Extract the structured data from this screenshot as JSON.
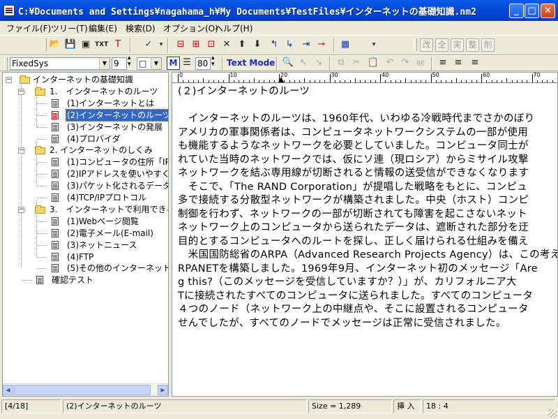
{
  "window": {
    "title": "C:¥Documents and Settings¥nagahama_h¥My Documents¥TestFiles¥インターネットの基礎知識.nm2",
    "minimize": "_",
    "maximize": "□",
    "close": "✕"
  },
  "menu": [
    "ファイル(F)",
    "ツリー(T)",
    "編集(E)",
    "検索(D)",
    "オプション(O)",
    "ヘルプ(H)"
  ],
  "toolbar1": {
    "kanji_buttons": [
      "改",
      "全",
      "実",
      "整",
      "削"
    ]
  },
  "toolbar2": {
    "font": "FixedSys",
    "font_size": "9",
    "box_option": "□",
    "m_label": "M",
    "indent": "80",
    "text_mode": "Text Mode"
  },
  "tree": {
    "root": "インターネットの基礎知識",
    "nodes": [
      {
        "label": "1.　インターネットのルーツ",
        "level": 1,
        "type": "folder"
      },
      {
        "label": "(1)インターネットとは",
        "level": 2,
        "type": "page"
      },
      {
        "label": "(2)インターネットのルーツ",
        "level": 2,
        "type": "page",
        "selected": true
      },
      {
        "label": "(3)インターネットの発展",
        "level": 2,
        "type": "page"
      },
      {
        "label": "(4)プロバイダ",
        "level": 2,
        "type": "page"
      },
      {
        "label": "2. インターネットのしくみ",
        "level": 1,
        "type": "folder"
      },
      {
        "label": "(1)コンピュータの住所「IP7",
        "level": 2,
        "type": "page"
      },
      {
        "label": "(2)IPアドレスを使いやすく",
        "level": 2,
        "type": "page"
      },
      {
        "label": "(3)パケット化されるデータ",
        "level": 2,
        "type": "page"
      },
      {
        "label": "(4)TCP/IPプロトコル",
        "level": 2,
        "type": "page"
      },
      {
        "label": "3.　インターネットで利用できる",
        "level": 1,
        "type": "folder"
      },
      {
        "label": "(1)Webページ閲覧",
        "level": 2,
        "type": "page"
      },
      {
        "label": "(2)電子メール(E-mail)",
        "level": 2,
        "type": "page"
      },
      {
        "label": "(3)ネットニュース",
        "level": 2,
        "type": "page"
      },
      {
        "label": "(4)FTP",
        "level": 2,
        "type": "page"
      },
      {
        "label": "(5)その他のインターネット",
        "level": 2,
        "type": "page"
      },
      {
        "label": "確認テスト",
        "level": 1,
        "type": "page"
      }
    ]
  },
  "editor": {
    "ruler_labels": [
      "0",
      "10",
      "20",
      "30",
      "40",
      "50",
      "60",
      "70"
    ],
    "lines": [
      "(２)インターネットのルーツ",
      "",
      "　インターネットのルーツは、1960年代、いわゆる冷戦時代までさかのぼり",
      "アメリカの軍事関係者は、コンピュータネットワークシステムの一部が使用",
      "も機能するようなネットワークを必要としていました。コンピュータ同士が",
      "れていた当時のネットワークでは、仮にソ連（現ロシア）からミサイル攻撃",
      "ネットワークを結ぶ専用線が切断されると情報の送受信ができなくなります",
      "　そこで、「The RAND Corporation」が提唱した戦略をもとに、コンピュ",
      "多で接続する分散型ネットワークが構築されました。中央（ホスト）コンピ",
      "制御を行わず、ネットワークの一部が切断されても障害を起こさないネット",
      "ネットワーク上のコンピュータから送られたデータは、遮断された部分を迂",
      "目的とするコンピュータへのルートを探し、正しく届けられる仕組みを備え",
      "　米国国防総省のARPA（Advanced Research Projects Agency）は、この考え",
      "RPANETを構築しました。1969年9月、インターネット初のメッセージ「Are",
      "g this?（このメッセージを受信していますか？）」が、カリフォルニア大",
      "Tに接続されたすべてのコンピュータに送られました。すべてのコンピュータ",
      "４つのノード（ネットワーク上の中継点や、そこに設置されるコンピュータ",
      "せんでしたが、すべてのノードでメッセージは正常に受信されました。"
    ]
  },
  "status": {
    "page": "[4/18]",
    "node": "(2)インターネットのルーツ",
    "size": "Size = 1,289",
    "mode": "挿 入",
    "position": "18 : 4"
  }
}
